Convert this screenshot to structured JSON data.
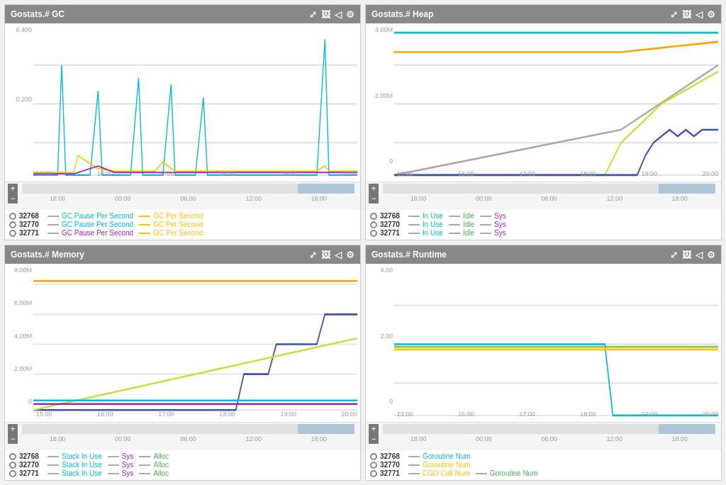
{
  "panels": [
    {
      "id": "gc",
      "title": "Gostats.# GC",
      "y_labels": [
        "0.400",
        "0.200",
        ""
      ],
      "x_labels": [
        "15:00",
        "16:00",
        "17:00",
        "18:00",
        "19:00",
        "20:00"
      ],
      "timeline_labels": [
        "18:00",
        "00:00",
        "06:00",
        "12:00",
        "18:00"
      ],
      "legend": [
        {
          "id": "32768",
          "color": "#888",
          "items": [
            {
              "label": "GC Pause Per Second",
              "color": "#00bcd4"
            },
            {
              "label": "GC Per Second",
              "color": "#ffc107"
            }
          ]
        },
        {
          "id": "32770",
          "color": "#888",
          "items": [
            {
              "label": "GC Pause Per Second",
              "color": "#00bcd4"
            },
            {
              "label": "GC Per Second",
              "color": "#ffc107"
            }
          ]
        },
        {
          "id": "32771",
          "color": "#888",
          "items": [
            {
              "label": "GC Pause Per Second",
              "color": "#9c27b0"
            },
            {
              "label": "GC Per Second",
              "color": "#ffc107"
            }
          ]
        }
      ]
    },
    {
      "id": "heap",
      "title": "Gostats.# Heap",
      "y_labels": [
        "4.00M",
        "2.00M",
        "0"
      ],
      "x_labels": [
        "15:00",
        "16:00",
        "17:00",
        "18:00",
        "19:00",
        "20:00"
      ],
      "timeline_labels": [
        "18:00",
        "00:00",
        "06:00",
        "12:00",
        "18:00"
      ],
      "legend": [
        {
          "id": "32768",
          "color": "#888",
          "items": [
            {
              "label": "In Use",
              "color": "#00bcd4"
            },
            {
              "label": "Idle",
              "color": "#4caf50"
            },
            {
              "label": "Sys",
              "color": "#9c27b0"
            }
          ]
        },
        {
          "id": "32770",
          "color": "#888",
          "items": [
            {
              "label": "In Use",
              "color": "#00bcd4"
            },
            {
              "label": "Idle",
              "color": "#4caf50"
            },
            {
              "label": "Sys",
              "color": "#9c27b0"
            }
          ]
        },
        {
          "id": "32771",
          "color": "#888",
          "items": [
            {
              "label": "In Use",
              "color": "#00bcd4"
            },
            {
              "label": "Idle",
              "color": "#4caf50"
            },
            {
              "label": "Sys",
              "color": "#9c27b0"
            }
          ]
        }
      ]
    },
    {
      "id": "memory",
      "title": "Gostats.# Memory",
      "y_labels": [
        "8.00M",
        "6.00M",
        "4.00M",
        "2.00M",
        "0"
      ],
      "x_labels": [
        "15:00",
        "16:00",
        "17:00",
        "18:00",
        "19:00",
        "20:00"
      ],
      "timeline_labels": [
        "18:00",
        "00:00",
        "06:00",
        "12:00",
        "18:00"
      ],
      "legend": [
        {
          "id": "32768",
          "color": "#888",
          "items": [
            {
              "label": "Stack In Use",
              "color": "#00bcd4"
            },
            {
              "label": "Sys",
              "color": "#9c27b0"
            },
            {
              "label": "Alloc",
              "color": "#4caf50"
            }
          ]
        },
        {
          "id": "32770",
          "color": "#888",
          "items": [
            {
              "label": "Stack In Use",
              "color": "#00bcd4"
            },
            {
              "label": "Sys",
              "color": "#9c27b0"
            },
            {
              "label": "Alloc",
              "color": "#4caf50"
            }
          ]
        },
        {
          "id": "32771",
          "color": "#888",
          "items": [
            {
              "label": "Stack In Use",
              "color": "#00bcd4"
            },
            {
              "label": "Sys",
              "color": "#9c27b0"
            },
            {
              "label": "Alloc",
              "color": "#4caf50"
            }
          ]
        }
      ]
    },
    {
      "id": "runtime",
      "title": "Gostats.# Runtime",
      "y_labels": [
        "4.00",
        "2.00",
        "0"
      ],
      "x_labels": [
        "15:00",
        "16:00",
        "17:00",
        "18:00",
        "19:00",
        "20:00"
      ],
      "timeline_labels": [
        "18:00",
        "00:00",
        "06:00",
        "12:00",
        "18:00"
      ],
      "legend": [
        {
          "id": "32768",
          "color": "#888",
          "items": [
            {
              "label": "Goroutine Num",
              "color": "#00bcd4"
            }
          ]
        },
        {
          "id": "32770",
          "color": "#888",
          "items": [
            {
              "label": "Goroutine Num",
              "color": "#ffc107"
            }
          ]
        },
        {
          "id": "32771",
          "color": "#888",
          "items": [
            {
              "label": "CGO Call Num",
              "color": "#ffc107"
            },
            {
              "label": "Goroutine Num",
              "color": "#4caf50"
            }
          ]
        }
      ]
    }
  ],
  "actions": {
    "expand": "⤢",
    "camera": "📷",
    "share": "◁",
    "settings": "⚙"
  },
  "timeline": {
    "plus": "+",
    "minus": "−"
  }
}
